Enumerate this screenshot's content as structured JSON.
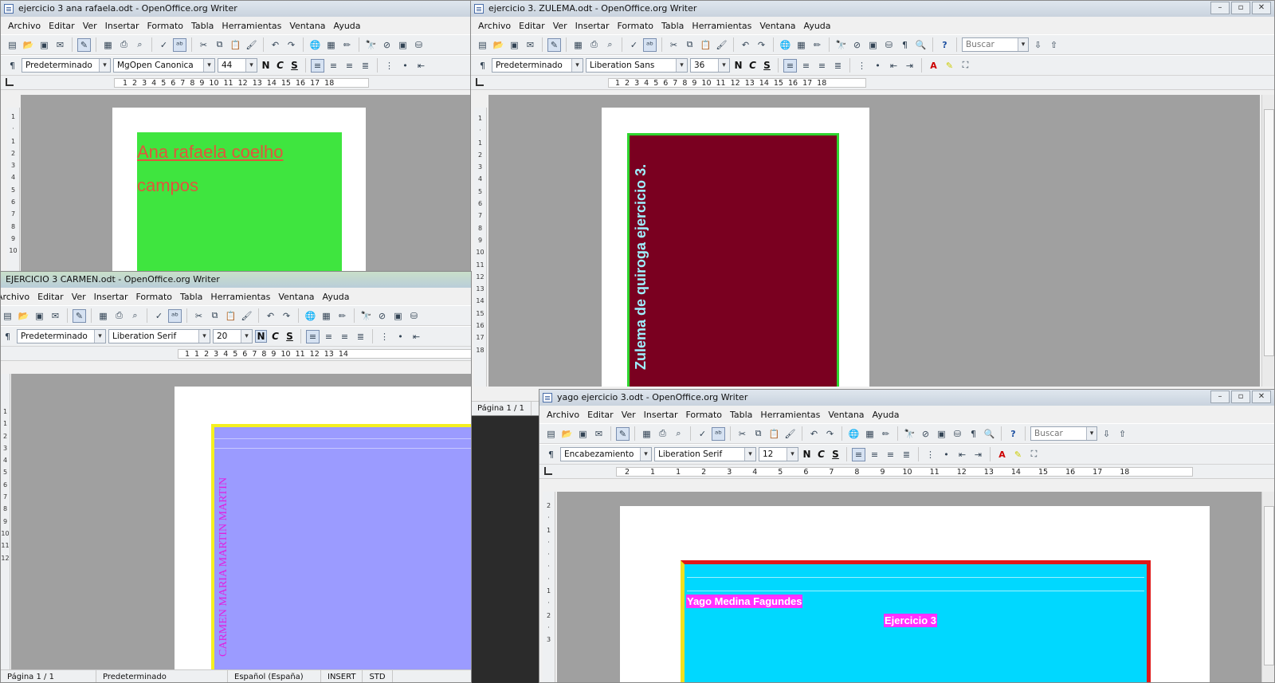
{
  "windows": {
    "ana": {
      "title": "ejercicio 3 ana rafaela.odt - OpenOffice.org Writer",
      "style": "Predeterminado",
      "font": "MgOpen Canonica",
      "size": "44",
      "ruler": [
        "1",
        "2",
        "3",
        "4",
        "5",
        "6",
        "7",
        "8",
        "9",
        "10",
        "11",
        "12",
        "13",
        "14",
        "15",
        "16",
        "17",
        "18"
      ],
      "text_line1": "Ana rafaela coelho",
      "text_line2": "campos",
      "colors": {
        "box": "#3fe53f",
        "text": "#e0563c"
      }
    },
    "zulema": {
      "title": "ejercicio 3. ZULEMA.odt - OpenOffice.org Writer",
      "style": "Predeterminado",
      "font": "Liberation Sans",
      "size": "36",
      "search_placeholder": "Buscar",
      "ruler": [
        "1",
        "2",
        "3",
        "4",
        "5",
        "6",
        "7",
        "8",
        "9",
        "10",
        "11",
        "12",
        "13",
        "14",
        "15",
        "16",
        "17",
        "18"
      ],
      "text": "Zulema  de   quiroga ejercicio 3.",
      "status_page": "Página 1 / 1",
      "colors": {
        "box": "#7a0020",
        "border": "#2fd52f",
        "text": "#9ff0ff"
      }
    },
    "carmen": {
      "title": "EJERCICIO 3 CARMEN.odt - OpenOffice.org Writer",
      "style": "Predeterminado",
      "font": "Liberation Serif",
      "size": "20",
      "ruler": [
        "1",
        "1",
        "2",
        "3",
        "4",
        "5",
        "6",
        "7",
        "8",
        "9",
        "10",
        "11",
        "12",
        "13",
        "14"
      ],
      "text": "CARMEN MARIA MARTIN MARTIN",
      "colors": {
        "box": "#9b9bff",
        "border": "#f5f020",
        "text": "#e020e0"
      }
    },
    "yago": {
      "title": "yago ejercicio 3.odt - OpenOffice.org Writer",
      "style": "Encabezamiento",
      "font": "Liberation Serif",
      "size": "12",
      "search_placeholder": "Buscar",
      "ruler": [
        "2",
        "1",
        "1",
        "2",
        "3",
        "4",
        "5",
        "6",
        "7",
        "8",
        "9",
        "10",
        "11",
        "12",
        "13",
        "14",
        "15",
        "16",
        "17",
        "18"
      ],
      "text_name": "Yago Medina Fagundes",
      "text_ex": "Ejercicio 3",
      "colors": {
        "box": "#00d8ff",
        "border": "#e01818",
        "highlight": "#ff30ff",
        "text": "#ffffff"
      }
    }
  },
  "menus": [
    "Archivo",
    "Editar",
    "Ver",
    "Insertar",
    "Formato",
    "Tabla",
    "Herramientas",
    "Ventana",
    "Ayuda"
  ],
  "status": {
    "page": "Página 1 / 1",
    "style": "Predeterminado",
    "lang": "Español (España)",
    "mode": "INSERT",
    "sel": "STD"
  },
  "fmt_labels": {
    "bold": "N",
    "italic": "C",
    "underline": "S"
  }
}
